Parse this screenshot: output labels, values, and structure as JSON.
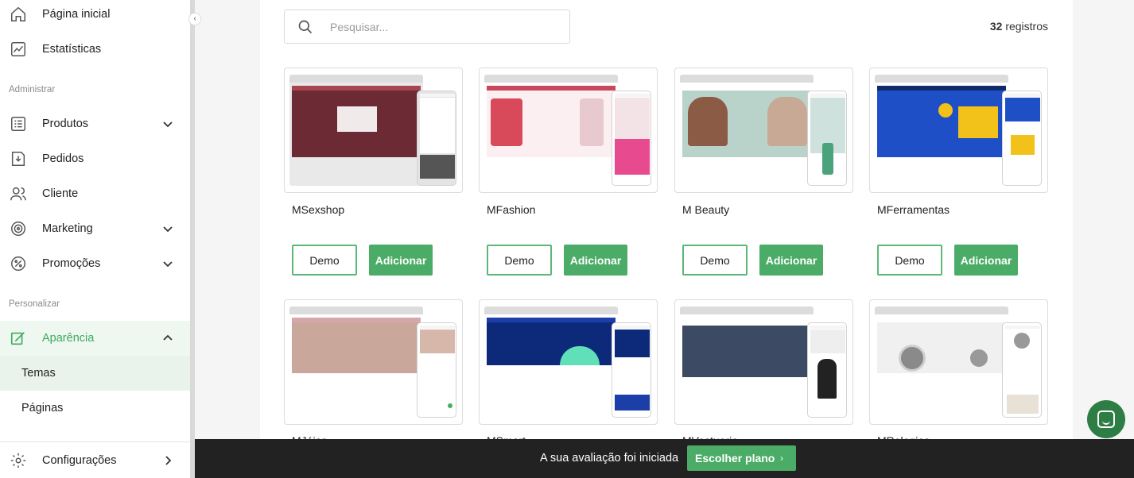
{
  "sidebar": {
    "items": [
      {
        "label": "Página inicial",
        "icon": "home-icon"
      },
      {
        "label": "Estatísticas",
        "icon": "chart-icon"
      }
    ],
    "section_admin": "Administrar",
    "admin_items": [
      {
        "label": "Produtos",
        "icon": "list-icon"
      },
      {
        "label": "Pedidos",
        "icon": "orders-icon"
      },
      {
        "label": "Cliente",
        "icon": "users-icon"
      },
      {
        "label": "Marketing",
        "icon": "target-icon"
      },
      {
        "label": "Promoções",
        "icon": "percent-icon"
      }
    ],
    "section_personalize": "Personalizar",
    "appearance": {
      "label": "Aparência",
      "icon": "edit-icon"
    },
    "sub_items": [
      {
        "label": "Temas"
      },
      {
        "label": "Páginas"
      }
    ],
    "config": {
      "label": "Configurações",
      "icon": "gear-icon"
    }
  },
  "search": {
    "placeholder": "Pesquisar..."
  },
  "records": {
    "count": "32",
    "label": "registros"
  },
  "themes": [
    {
      "name": "MSexshop",
      "demo": "Demo",
      "add": "Adicionar",
      "accent": "#6b2a34",
      "strip": "#a8434f"
    },
    {
      "name": "MFashion",
      "demo": "Demo",
      "add": "Adicionar",
      "accent": "#f6dce0",
      "strip": "#c9465b"
    },
    {
      "name": "M Beauty",
      "demo": "Demo",
      "add": "Adicionar",
      "accent": "#a8c7bf",
      "strip": "#ffffff"
    },
    {
      "name": "MFerramentas",
      "demo": "Demo",
      "add": "Adicionar",
      "accent": "#1f4fc6",
      "strip": "#0f2a6b"
    },
    {
      "name": "MJóias",
      "accent": "#c9a79a",
      "strip": "#d7a6ad"
    },
    {
      "name": "MSmart",
      "accent": "#0d2a7a",
      "strip": "#1b3ea8"
    },
    {
      "name": "MVestuario",
      "accent": "#3c4a63",
      "strip": "#ffffff"
    },
    {
      "name": "MRelogios",
      "accent": "#d9d9d9",
      "strip": "#ffffff"
    }
  ],
  "trial": {
    "message": "A sua avaliação foi iniciada",
    "button": "Escolher plano"
  }
}
